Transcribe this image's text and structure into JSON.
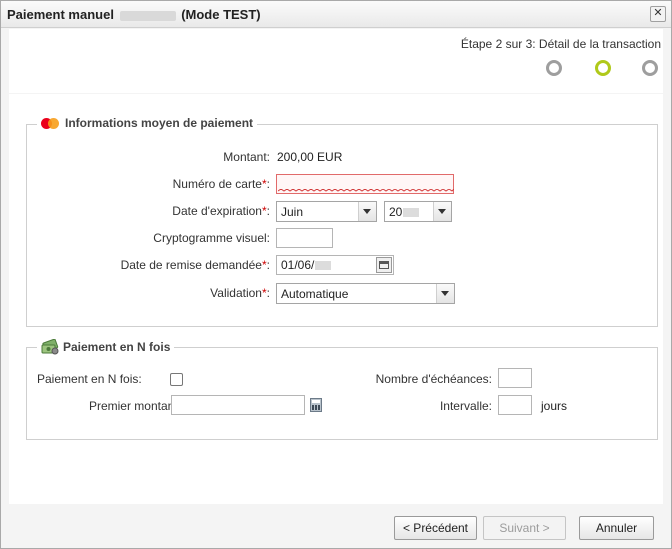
{
  "dialog": {
    "title_prefix": "Paiement manuel",
    "title_suffix": "(Mode TEST)",
    "close_label": "✕"
  },
  "steps": {
    "text": "Étape 2 sur 3: Détail de la transaction",
    "count": 3,
    "current": 2,
    "active_color": "#b0c91a",
    "inactive_color": "#9e9e9e"
  },
  "payment_info": {
    "legend": "Informations moyen de paiement",
    "amount_label": "Montant:",
    "amount_value": "200,00 EUR",
    "card_number_label": "Numéro de carte",
    "card_number_value": "",
    "expiry_label": "Date d'expiration",
    "expiry_month": "Juin",
    "expiry_year_prefix": "20",
    "cvv_label": "Cryptogramme visuel:",
    "cvv_value": "",
    "remittance_label": "Date de remise demandée",
    "remittance_value_prefix": "01/06/",
    "validation_label": "Validation",
    "validation_value": "Automatique",
    "required_mark": "*",
    "colon": ":"
  },
  "installments": {
    "legend": "Paiement en N fois",
    "enable_label": "Paiement en N fois:",
    "enabled": false,
    "first_amount_label": "Premier montant:",
    "first_amount_value": "",
    "count_label": "Nombre d'échéances:",
    "count_value": "",
    "interval_label": "Intervalle:",
    "interval_value": "",
    "interval_unit": "jours"
  },
  "footer": {
    "previous_label": "< Précédent",
    "next_label": "Suivant >",
    "cancel_label": "Annuler"
  },
  "colors": {
    "required": "#cc0000",
    "error_border": "#e16a6a"
  }
}
